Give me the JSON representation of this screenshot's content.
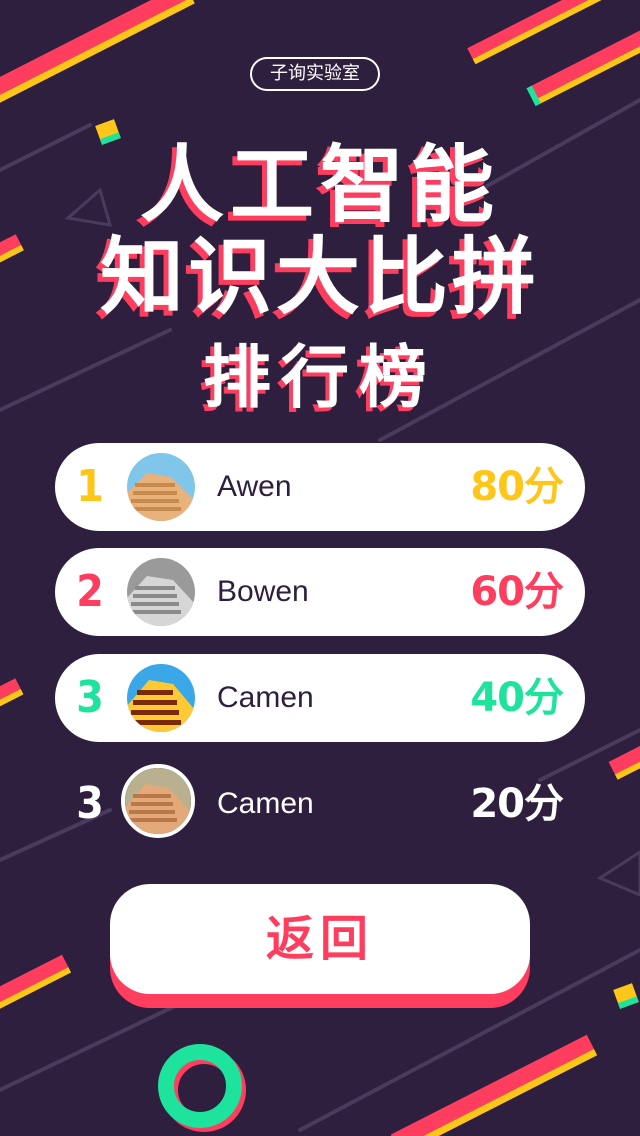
{
  "header": {
    "badge": "子询实验室",
    "title_line1": "人工智能",
    "title_line2": "知识大比拼",
    "title_line3": "排行榜"
  },
  "leaderboard": [
    {
      "rank": "1",
      "name": "Awen",
      "score": "80分",
      "color": "#ffc61a"
    },
    {
      "rank": "2",
      "name": "Bowen",
      "score": "60分",
      "color": "#ff3d5f"
    },
    {
      "rank": "3",
      "name": "Camen",
      "score": "40分",
      "color": "#1de39c"
    },
    {
      "rank": "3",
      "name": "Camen",
      "score": "20分",
      "color": "#ffffff"
    }
  ],
  "back_button": {
    "label": "返回"
  },
  "colors": {
    "background": "#2d1f3d",
    "accent_red": "#ff3d5f",
    "accent_yellow": "#ffc61a",
    "accent_green": "#1de39c"
  }
}
